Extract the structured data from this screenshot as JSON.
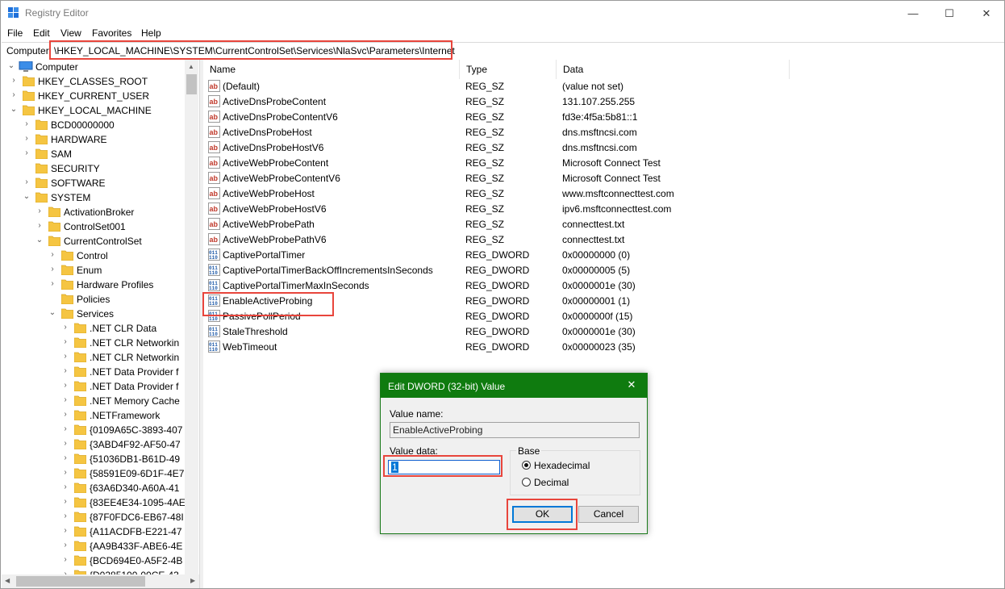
{
  "window": {
    "title": "Registry Editor",
    "min_glyph": "—",
    "max_glyph": "☐",
    "close_glyph": "✕"
  },
  "menu": [
    "File",
    "Edit",
    "View",
    "Favorites",
    "Help"
  ],
  "address": {
    "root": "Computer",
    "path": "\\HKEY_LOCAL_MACHINE\\SYSTEM\\CurrentControlSet\\Services\\NlaSvc\\Parameters\\Internet"
  },
  "tree": {
    "root": "Computer",
    "items": [
      {
        "label": "HKEY_CLASSES_ROOT",
        "chev": "›"
      },
      {
        "label": "HKEY_CURRENT_USER",
        "chev": "›"
      },
      {
        "label": "HKEY_LOCAL_MACHINE",
        "chev": "⌄"
      },
      {
        "label": "BCD00000000",
        "chev": "›"
      },
      {
        "label": "HARDWARE",
        "chev": "›"
      },
      {
        "label": "SAM",
        "chev": "›"
      },
      {
        "label": "SECURITY",
        "chev": ""
      },
      {
        "label": "SOFTWARE",
        "chev": "›"
      },
      {
        "label": "SYSTEM",
        "chev": "⌄"
      },
      {
        "label": "ActivationBroker",
        "chev": "›"
      },
      {
        "label": "ControlSet001",
        "chev": "›"
      },
      {
        "label": "CurrentControlSet",
        "chev": "⌄"
      },
      {
        "label": "Control",
        "chev": "›"
      },
      {
        "label": "Enum",
        "chev": "›"
      },
      {
        "label": "Hardware Profiles",
        "chev": "›"
      },
      {
        "label": "Policies",
        "chev": ""
      },
      {
        "label": "Services",
        "chev": "⌄"
      },
      {
        "label": ".NET CLR Data",
        "chev": "›"
      },
      {
        "label": ".NET CLR Networkin",
        "chev": "›"
      },
      {
        "label": ".NET CLR Networkin",
        "chev": "›"
      },
      {
        "label": ".NET Data Provider f",
        "chev": "›"
      },
      {
        "label": ".NET Data Provider f",
        "chev": "›"
      },
      {
        "label": ".NET Memory Cache",
        "chev": "›"
      },
      {
        "label": ".NETFramework",
        "chev": "›"
      },
      {
        "label": "{0109A65C-3893-407",
        "chev": "›"
      },
      {
        "label": "{3ABD4F92-AF50-47",
        "chev": "›"
      },
      {
        "label": "{51036DB1-B61D-49",
        "chev": "›"
      },
      {
        "label": "{58591E09-6D1F-4E7",
        "chev": "›"
      },
      {
        "label": "{63A6D340-A60A-41",
        "chev": "›"
      },
      {
        "label": "{83EE4E34-1095-4AE",
        "chev": "›"
      },
      {
        "label": "{87F0FDC6-EB67-48I",
        "chev": "›"
      },
      {
        "label": "{A11ACDFB-E221-47",
        "chev": "›"
      },
      {
        "label": "{AA9B433F-ABE6-4E",
        "chev": "›"
      },
      {
        "label": "{BCD694E0-A5F2-4B",
        "chev": "›"
      },
      {
        "label": "{D0285100-00CE-43",
        "chev": "›"
      }
    ]
  },
  "list": {
    "columns": [
      "Name",
      "Type",
      "Data"
    ],
    "rows": [
      {
        "name": "(Default)",
        "type": "REG_SZ",
        "data": "(value not set)",
        "icon": "string-value-icon"
      },
      {
        "name": "ActiveDnsProbeContent",
        "type": "REG_SZ",
        "data": "131.107.255.255",
        "icon": "string-value-icon"
      },
      {
        "name": "ActiveDnsProbeContentV6",
        "type": "REG_SZ",
        "data": "fd3e:4f5a:5b81::1",
        "icon": "string-value-icon"
      },
      {
        "name": "ActiveDnsProbeHost",
        "type": "REG_SZ",
        "data": "dns.msftncsi.com",
        "icon": "string-value-icon"
      },
      {
        "name": "ActiveDnsProbeHostV6",
        "type": "REG_SZ",
        "data": "dns.msftncsi.com",
        "icon": "string-value-icon"
      },
      {
        "name": "ActiveWebProbeContent",
        "type": "REG_SZ",
        "data": "Microsoft Connect Test",
        "icon": "string-value-icon"
      },
      {
        "name": "ActiveWebProbeContentV6",
        "type": "REG_SZ",
        "data": "Microsoft Connect Test",
        "icon": "string-value-icon"
      },
      {
        "name": "ActiveWebProbeHost",
        "type": "REG_SZ",
        "data": "www.msftconnecttest.com",
        "icon": "string-value-icon"
      },
      {
        "name": "ActiveWebProbeHostV6",
        "type": "REG_SZ",
        "data": "ipv6.msftconnecttest.com",
        "icon": "string-value-icon"
      },
      {
        "name": "ActiveWebProbePath",
        "type": "REG_SZ",
        "data": "connecttest.txt",
        "icon": "string-value-icon"
      },
      {
        "name": "ActiveWebProbePathV6",
        "type": "REG_SZ",
        "data": "connecttest.txt",
        "icon": "string-value-icon"
      },
      {
        "name": "CaptivePortalTimer",
        "type": "REG_DWORD",
        "data": "0x00000000 (0)",
        "icon": "binary-value-icon"
      },
      {
        "name": "CaptivePortalTimerBackOffIncrementsInSeconds",
        "type": "REG_DWORD",
        "data": "0x00000005 (5)",
        "icon": "binary-value-icon"
      },
      {
        "name": "CaptivePortalTimerMaxInSeconds",
        "type": "REG_DWORD",
        "data": "0x0000001e (30)",
        "icon": "binary-value-icon"
      },
      {
        "name": "EnableActiveProbing",
        "type": "REG_DWORD",
        "data": "0x00000001 (1)",
        "icon": "binary-value-icon"
      },
      {
        "name": "PassivePollPeriod",
        "type": "REG_DWORD",
        "data": "0x0000000f (15)",
        "icon": "binary-value-icon"
      },
      {
        "name": "StaleThreshold",
        "type": "REG_DWORD",
        "data": "0x0000001e (30)",
        "icon": "binary-value-icon"
      },
      {
        "name": "WebTimeout",
        "type": "REG_DWORD",
        "data": "0x00000023 (35)",
        "icon": "binary-value-icon"
      }
    ]
  },
  "dialog": {
    "title": "Edit DWORD (32-bit) Value",
    "close_glyph": "✕",
    "value_name_label": "Value name:",
    "value_name": "EnableActiveProbing",
    "value_data_label": "Value data:",
    "value_data": "1",
    "base_label": "Base",
    "hex_label": "Hexadecimal",
    "dec_label": "Decimal",
    "selected_base": "Hexadecimal",
    "ok_label": "OK",
    "cancel_label": "Cancel"
  },
  "colors": {
    "highlight": "#e8453c",
    "dialog_title": "#0f7b0f",
    "folder": "#f5c542",
    "accent": "#0078d7"
  }
}
